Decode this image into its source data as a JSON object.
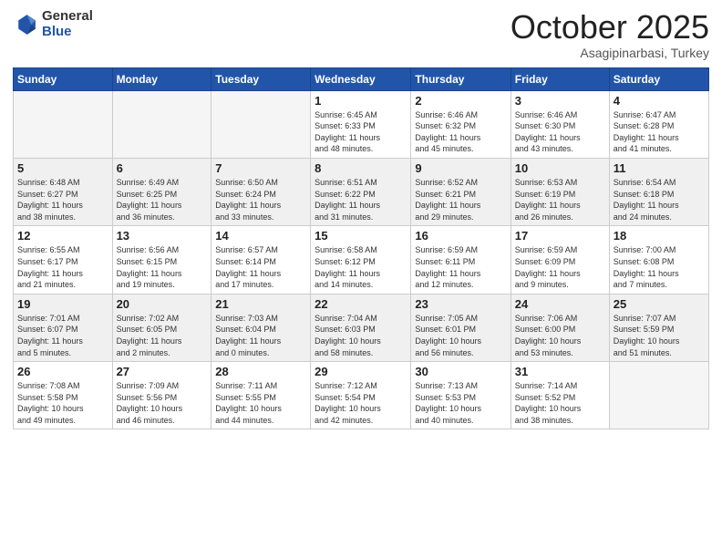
{
  "logo": {
    "general": "General",
    "blue": "Blue"
  },
  "header": {
    "month": "October 2025",
    "location": "Asagipinarbasi, Turkey"
  },
  "weekdays": [
    "Sunday",
    "Monday",
    "Tuesday",
    "Wednesday",
    "Thursday",
    "Friday",
    "Saturday"
  ],
  "weeks": [
    [
      {
        "day": "",
        "info": ""
      },
      {
        "day": "",
        "info": ""
      },
      {
        "day": "",
        "info": ""
      },
      {
        "day": "1",
        "info": "Sunrise: 6:45 AM\nSunset: 6:33 PM\nDaylight: 11 hours\nand 48 minutes."
      },
      {
        "day": "2",
        "info": "Sunrise: 6:46 AM\nSunset: 6:32 PM\nDaylight: 11 hours\nand 45 minutes."
      },
      {
        "day": "3",
        "info": "Sunrise: 6:46 AM\nSunset: 6:30 PM\nDaylight: 11 hours\nand 43 minutes."
      },
      {
        "day": "4",
        "info": "Sunrise: 6:47 AM\nSunset: 6:28 PM\nDaylight: 11 hours\nand 41 minutes."
      }
    ],
    [
      {
        "day": "5",
        "info": "Sunrise: 6:48 AM\nSunset: 6:27 PM\nDaylight: 11 hours\nand 38 minutes."
      },
      {
        "day": "6",
        "info": "Sunrise: 6:49 AM\nSunset: 6:25 PM\nDaylight: 11 hours\nand 36 minutes."
      },
      {
        "day": "7",
        "info": "Sunrise: 6:50 AM\nSunset: 6:24 PM\nDaylight: 11 hours\nand 33 minutes."
      },
      {
        "day": "8",
        "info": "Sunrise: 6:51 AM\nSunset: 6:22 PM\nDaylight: 11 hours\nand 31 minutes."
      },
      {
        "day": "9",
        "info": "Sunrise: 6:52 AM\nSunset: 6:21 PM\nDaylight: 11 hours\nand 29 minutes."
      },
      {
        "day": "10",
        "info": "Sunrise: 6:53 AM\nSunset: 6:19 PM\nDaylight: 11 hours\nand 26 minutes."
      },
      {
        "day": "11",
        "info": "Sunrise: 6:54 AM\nSunset: 6:18 PM\nDaylight: 11 hours\nand 24 minutes."
      }
    ],
    [
      {
        "day": "12",
        "info": "Sunrise: 6:55 AM\nSunset: 6:17 PM\nDaylight: 11 hours\nand 21 minutes."
      },
      {
        "day": "13",
        "info": "Sunrise: 6:56 AM\nSunset: 6:15 PM\nDaylight: 11 hours\nand 19 minutes."
      },
      {
        "day": "14",
        "info": "Sunrise: 6:57 AM\nSunset: 6:14 PM\nDaylight: 11 hours\nand 17 minutes."
      },
      {
        "day": "15",
        "info": "Sunrise: 6:58 AM\nSunset: 6:12 PM\nDaylight: 11 hours\nand 14 minutes."
      },
      {
        "day": "16",
        "info": "Sunrise: 6:59 AM\nSunset: 6:11 PM\nDaylight: 11 hours\nand 12 minutes."
      },
      {
        "day": "17",
        "info": "Sunrise: 6:59 AM\nSunset: 6:09 PM\nDaylight: 11 hours\nand 9 minutes."
      },
      {
        "day": "18",
        "info": "Sunrise: 7:00 AM\nSunset: 6:08 PM\nDaylight: 11 hours\nand 7 minutes."
      }
    ],
    [
      {
        "day": "19",
        "info": "Sunrise: 7:01 AM\nSunset: 6:07 PM\nDaylight: 11 hours\nand 5 minutes."
      },
      {
        "day": "20",
        "info": "Sunrise: 7:02 AM\nSunset: 6:05 PM\nDaylight: 11 hours\nand 2 minutes."
      },
      {
        "day": "21",
        "info": "Sunrise: 7:03 AM\nSunset: 6:04 PM\nDaylight: 11 hours\nand 0 minutes."
      },
      {
        "day": "22",
        "info": "Sunrise: 7:04 AM\nSunset: 6:03 PM\nDaylight: 10 hours\nand 58 minutes."
      },
      {
        "day": "23",
        "info": "Sunrise: 7:05 AM\nSunset: 6:01 PM\nDaylight: 10 hours\nand 56 minutes."
      },
      {
        "day": "24",
        "info": "Sunrise: 7:06 AM\nSunset: 6:00 PM\nDaylight: 10 hours\nand 53 minutes."
      },
      {
        "day": "25",
        "info": "Sunrise: 7:07 AM\nSunset: 5:59 PM\nDaylight: 10 hours\nand 51 minutes."
      }
    ],
    [
      {
        "day": "26",
        "info": "Sunrise: 7:08 AM\nSunset: 5:58 PM\nDaylight: 10 hours\nand 49 minutes."
      },
      {
        "day": "27",
        "info": "Sunrise: 7:09 AM\nSunset: 5:56 PM\nDaylight: 10 hours\nand 46 minutes."
      },
      {
        "day": "28",
        "info": "Sunrise: 7:11 AM\nSunset: 5:55 PM\nDaylight: 10 hours\nand 44 minutes."
      },
      {
        "day": "29",
        "info": "Sunrise: 7:12 AM\nSunset: 5:54 PM\nDaylight: 10 hours\nand 42 minutes."
      },
      {
        "day": "30",
        "info": "Sunrise: 7:13 AM\nSunset: 5:53 PM\nDaylight: 10 hours\nand 40 minutes."
      },
      {
        "day": "31",
        "info": "Sunrise: 7:14 AM\nSunset: 5:52 PM\nDaylight: 10 hours\nand 38 minutes."
      },
      {
        "day": "",
        "info": ""
      }
    ]
  ]
}
